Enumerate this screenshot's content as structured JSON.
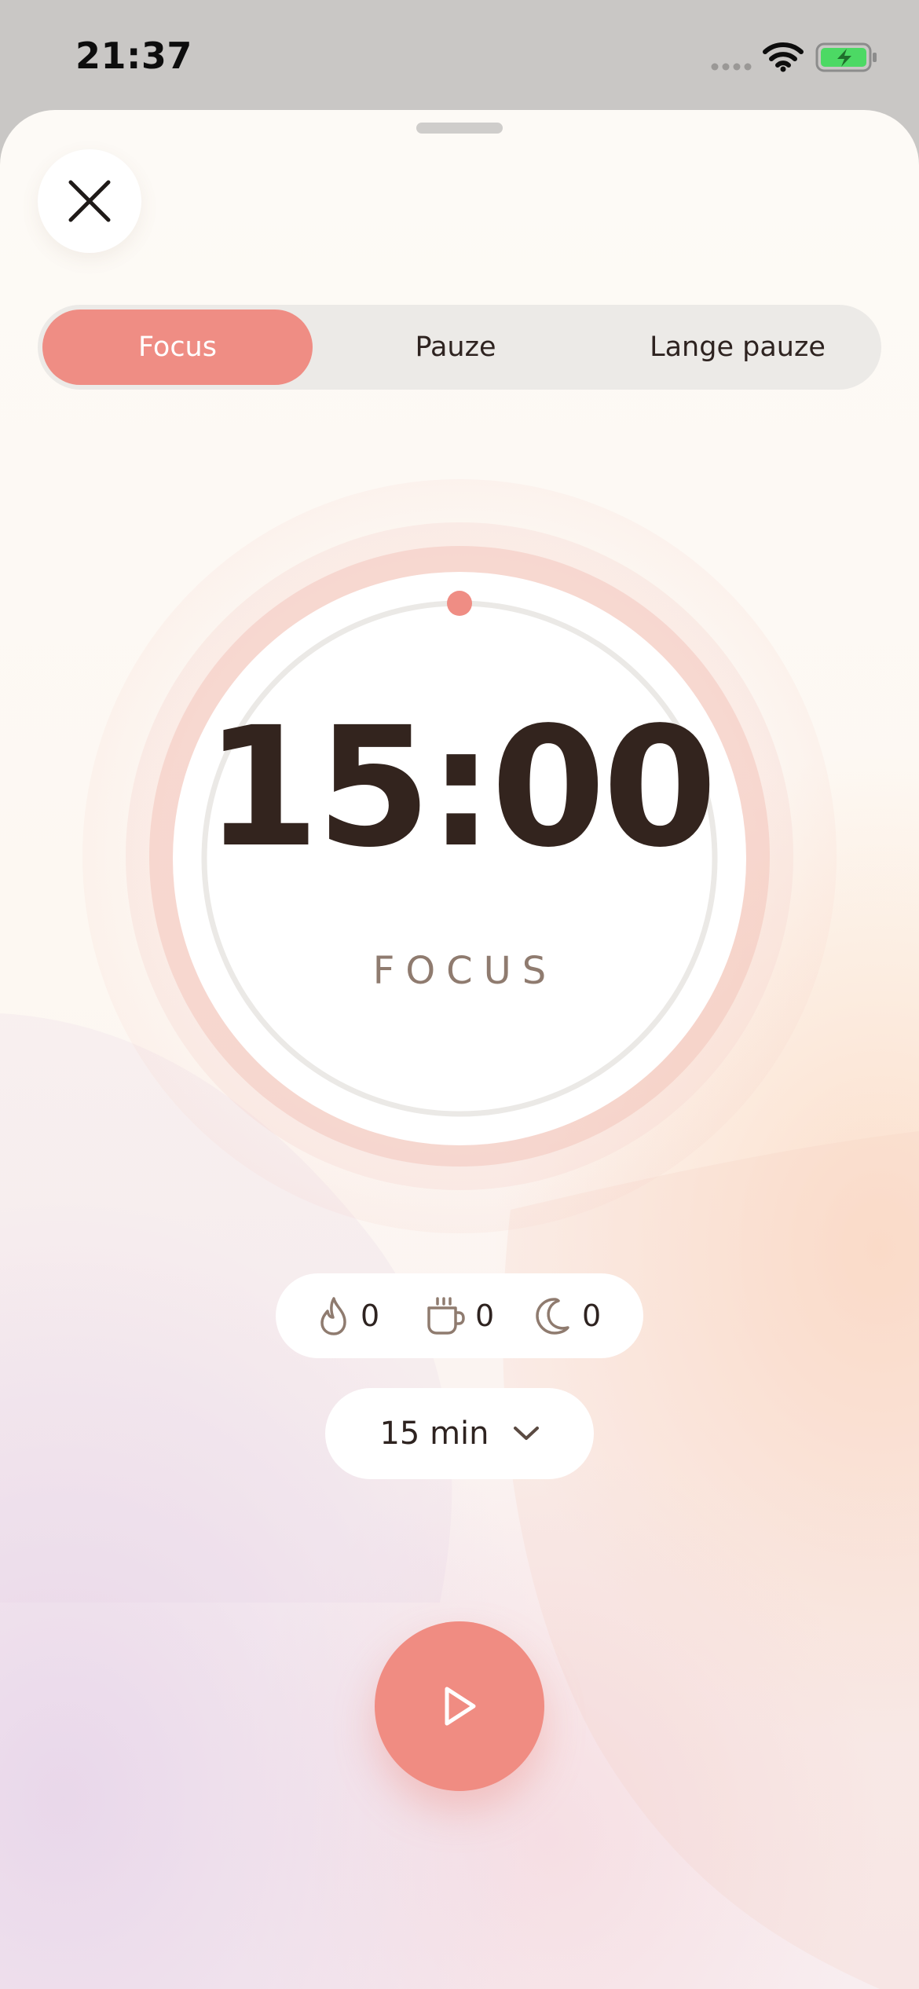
{
  "status_bar": {
    "time": "21:37"
  },
  "sheet": {
    "close_icon": "close-icon"
  },
  "mode_tabs": {
    "items": [
      {
        "label": "Focus",
        "selected": true
      },
      {
        "label": "Pauze",
        "selected": false
      },
      {
        "label": "Lange pauze",
        "selected": false
      }
    ]
  },
  "timer": {
    "time": "15:00",
    "mode_label": "FOCUS",
    "progress": 0
  },
  "counters": {
    "focus_count": "0",
    "break_count": "0",
    "long_break_count": "0",
    "icons": [
      "flame-icon",
      "coffee-cup-icon",
      "moon-icon"
    ]
  },
  "duration": {
    "selected": "15 min"
  },
  "controls": {
    "play_icon": "play-icon"
  },
  "colors": {
    "accent": "#ef8d84",
    "text_dark": "#33241e",
    "text_muted": "#8f7b6f",
    "battery_green": "#4cd964"
  }
}
